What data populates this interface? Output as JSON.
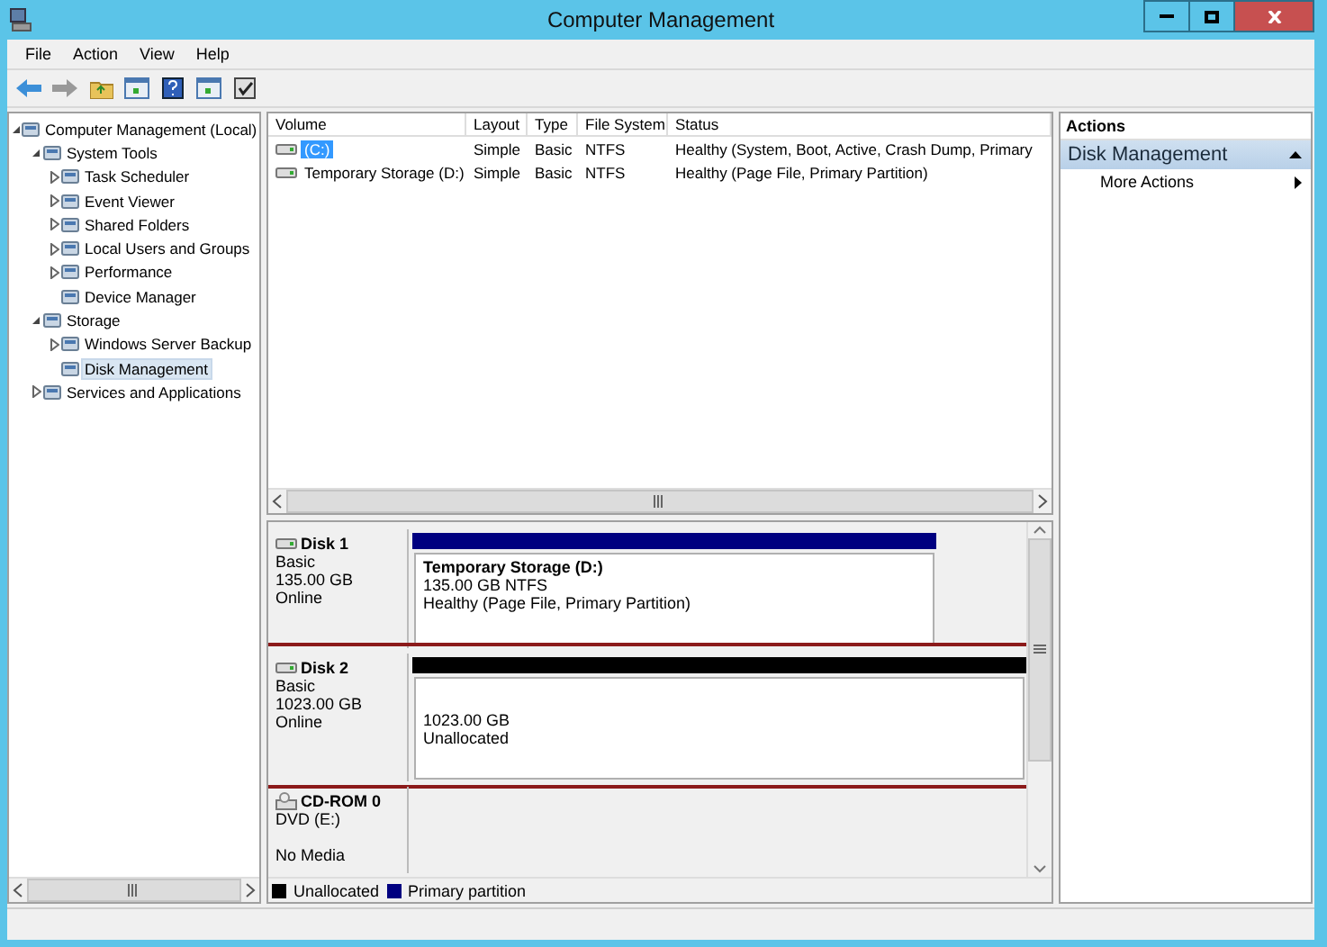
{
  "window": {
    "title": "Computer Management"
  },
  "menu": [
    "File",
    "Action",
    "View",
    "Help"
  ],
  "tree": [
    {
      "label": "Computer Management (Local)",
      "selected": false,
      "expanded": true,
      "children": [
        {
          "label": "System Tools",
          "selected": false,
          "expanded": true,
          "children": [
            {
              "label": "Task Scheduler",
              "selected": false,
              "expanded": false
            },
            {
              "label": "Event Viewer",
              "selected": false,
              "expanded": false
            },
            {
              "label": "Shared Folders",
              "selected": false,
              "expanded": false
            },
            {
              "label": "Local Users and Groups",
              "selected": false,
              "expanded": false
            },
            {
              "label": "Performance",
              "selected": false,
              "expanded": false
            },
            {
              "label": "Device Manager",
              "selected": false
            }
          ]
        },
        {
          "label": "Storage",
          "selected": false,
          "expanded": true,
          "children": [
            {
              "label": "Windows Server Backup",
              "selected": false,
              "expanded": false
            },
            {
              "label": "Disk Management",
              "selected": true
            }
          ]
        },
        {
          "label": "Services and Applications",
          "selected": false,
          "expanded": false
        }
      ]
    }
  ],
  "volumes": {
    "columns": [
      "Volume",
      "Layout",
      "Type",
      "File System",
      "Status"
    ],
    "rows": [
      {
        "cells": [
          "(C:)",
          "Simple",
          "Basic",
          "NTFS",
          "Healthy (System, Boot, Active, Crash Dump, Primary"
        ],
        "selected": true
      },
      {
        "cells": [
          "Temporary Storage (D:)",
          "Simple",
          "Basic",
          "NTFS",
          "Healthy (Page File, Primary Partition)"
        ],
        "selected": false
      }
    ]
  },
  "disks": [
    {
      "kind": "disk",
      "name": "Disk 1",
      "lines": [
        "Basic",
        "135.00 GB",
        "Online"
      ],
      "highlighted": false,
      "partition": {
        "color": "#000080",
        "title": "Temporary Storage  (D:)",
        "lines": [
          "135.00 GB NTFS",
          "Healthy (Page File, Primary Partition)"
        ]
      }
    },
    {
      "kind": "disk",
      "name": "Disk 2",
      "lines": [
        "Basic",
        "1023.00 GB",
        "Online"
      ],
      "highlighted": true,
      "partition": {
        "color": "#000000",
        "lines": [
          "1023.00 GB",
          "Unallocated"
        ]
      }
    },
    {
      "kind": "cdrom",
      "name": "CD-ROM 0",
      "lines": [
        "DVD (E:)",
        "No Media"
      ],
      "highlighted": false
    }
  ],
  "legend": [
    {
      "label": "Unallocated",
      "color": "#000000"
    },
    {
      "label": "Primary partition",
      "color": "#000080"
    }
  ],
  "actions": {
    "header": "Actions",
    "section": "Disk Management",
    "items": [
      "More Actions"
    ]
  }
}
